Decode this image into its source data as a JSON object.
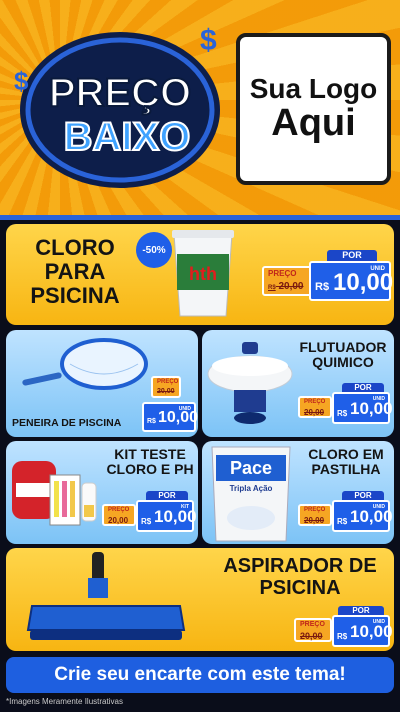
{
  "badge": {
    "line1": "PREÇO",
    "line2": "BAIXO"
  },
  "logo": {
    "line1": "Sua Logo",
    "line2": "Aqui"
  },
  "products": [
    {
      "title_lines": [
        "CLORO",
        "PARA",
        "PSICINA"
      ],
      "discount": "-50%",
      "old_label": "PREÇO",
      "old_prefix": "R$",
      "old_value": "20,00",
      "por": "POR",
      "currency": "R$",
      "price": "10,00",
      "unit": "UNID"
    },
    {
      "title_lines": [
        "PENEIRA DE PISCINA"
      ],
      "old_label": "PREÇO",
      "old_prefix": "R$",
      "old_value": "20,00",
      "currency": "R$",
      "price": "10,00",
      "unit": "UNID"
    },
    {
      "title_lines": [
        "FLUTUADOR",
        "QUIMICO"
      ],
      "old_label": "PREÇO",
      "old_prefix": "R$",
      "old_value": "20,00",
      "por": "POR",
      "currency": "R$",
      "price": "10,00",
      "unit": "UNID"
    },
    {
      "title_lines": [
        "KIT TESTE",
        "CLORO E PH"
      ],
      "old_label": "PREÇO",
      "old_prefix": "R$",
      "old_value": "20,00",
      "por": "POR",
      "currency": "R$",
      "price": "10,00",
      "unit": "KIT"
    },
    {
      "title_lines": [
        "CLORO EM",
        "PASTILHA"
      ],
      "old_label": "PREÇO",
      "old_prefix": "R$",
      "old_value": "20,00",
      "por": "POR",
      "currency": "R$",
      "price": "10,00",
      "unit": "UNID"
    },
    {
      "title_lines": [
        "ASPIRADOR DE",
        "PSICINA"
      ],
      "old_label": "PREÇO",
      "old_prefix": "R$",
      "old_value": "20,00",
      "por": "POR",
      "currency": "R$",
      "price": "10,00",
      "unit": "UNID"
    }
  ],
  "product_labels": {
    "bucket": "hth",
    "pace": "Pace",
    "pace_sub": "Tripla Ação"
  },
  "cta": "Crie seu encarte com este tema!",
  "footnote": "*Imagens Meramente Ilustrativas"
}
